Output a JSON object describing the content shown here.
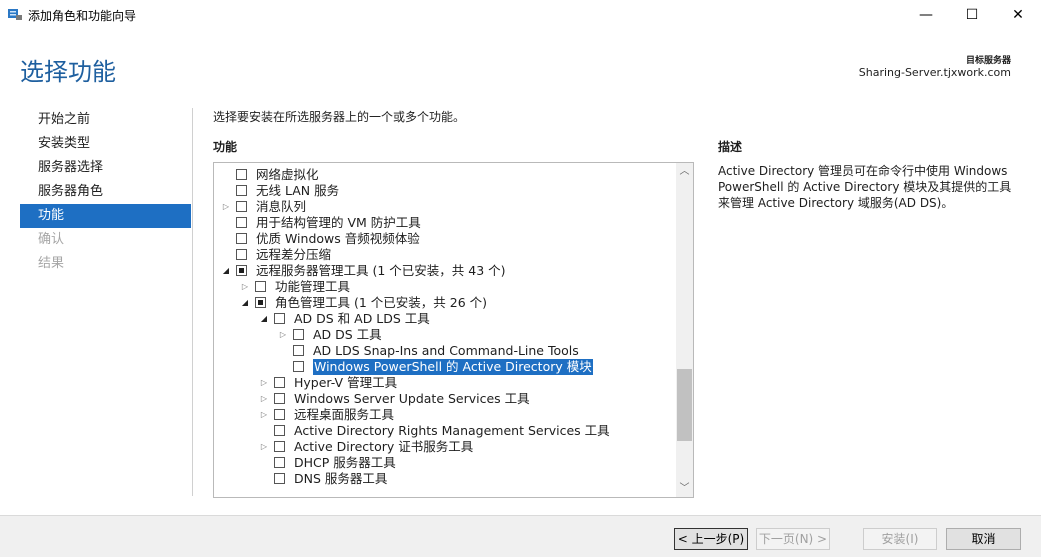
{
  "window": {
    "title": "添加角色和功能向导",
    "minimize_glyph": "—",
    "maximize_glyph": "☐",
    "close_glyph": "✕"
  },
  "header": {
    "page_title": "选择功能",
    "target_server_label": "目标服务器",
    "target_server_value": "Sharing-Server.tjxwork.com"
  },
  "nav": {
    "items": [
      {
        "label": "开始之前",
        "state": "normal"
      },
      {
        "label": "安装类型",
        "state": "normal"
      },
      {
        "label": "服务器选择",
        "state": "normal"
      },
      {
        "label": "服务器角色",
        "state": "normal"
      },
      {
        "label": "功能",
        "state": "active"
      },
      {
        "label": "确认",
        "state": "disabled"
      },
      {
        "label": "结果",
        "state": "disabled"
      }
    ]
  },
  "main": {
    "instruction": "选择要安装在所选服务器上的一个或多个功能。",
    "features_header": "功能",
    "description_header": "描述",
    "description_text": "Active Directory 管理员可在命令行中使用 Windows PowerShell 的 Active Directory 模块及其提供的工具来管理 Active Directory 域服务(AD DS)。"
  },
  "tree": {
    "rows": [
      {
        "label": "网络虚拟化",
        "level": 0,
        "expander": "none",
        "check": "empty"
      },
      {
        "label": "无线 LAN 服务",
        "level": 0,
        "expander": "none",
        "check": "empty"
      },
      {
        "label": "消息队列",
        "level": 0,
        "expander": "collapsed",
        "check": "empty"
      },
      {
        "label": "用于结构管理的 VM 防护工具",
        "level": 0,
        "expander": "none",
        "check": "empty"
      },
      {
        "label": "优质 Windows 音频视频体验",
        "level": 0,
        "expander": "none",
        "check": "empty"
      },
      {
        "label": "远程差分压缩",
        "level": 0,
        "expander": "none",
        "check": "empty"
      },
      {
        "label": "远程服务器管理工具 (1 个已安装，共 43 个)",
        "level": 0,
        "expander": "expanded",
        "check": "partial"
      },
      {
        "label": "功能管理工具",
        "level": 1,
        "expander": "collapsed",
        "check": "empty"
      },
      {
        "label": "角色管理工具 (1 个已安装，共 26 个)",
        "level": 1,
        "expander": "expanded",
        "check": "partial"
      },
      {
        "label": "AD DS 和 AD LDS 工具",
        "level": 2,
        "expander": "expanded",
        "check": "empty"
      },
      {
        "label": "AD DS 工具",
        "level": 3,
        "expander": "collapsed",
        "check": "empty"
      },
      {
        "label": "AD LDS Snap-Ins and Command-Line Tools",
        "level": 3,
        "expander": "none",
        "check": "empty"
      },
      {
        "label": "Windows PowerShell 的 Active Directory 模块",
        "level": 3,
        "expander": "none",
        "check": "empty",
        "selected": true
      },
      {
        "label": "Hyper-V 管理工具",
        "level": 2,
        "expander": "collapsed",
        "check": "empty"
      },
      {
        "label": "Windows Server Update Services 工具",
        "level": 2,
        "expander": "collapsed",
        "check": "empty"
      },
      {
        "label": "远程桌面服务工具",
        "level": 2,
        "expander": "collapsed",
        "check": "empty"
      },
      {
        "label": "Active Directory Rights Management Services 工具",
        "level": 2,
        "expander": "none",
        "check": "empty"
      },
      {
        "label": "Active Directory 证书服务工具",
        "level": 2,
        "expander": "collapsed",
        "check": "empty"
      },
      {
        "label": "DHCP 服务器工具",
        "level": 2,
        "expander": "none",
        "check": "empty"
      },
      {
        "label": "DNS 服务器工具",
        "level": 2,
        "expander": "none",
        "check": "empty"
      }
    ]
  },
  "footer": {
    "prev_label": "< 上一步(P)",
    "next_label": "下一页(N) >",
    "install_label": "安装(I)",
    "cancel_label": "取消"
  },
  "colors": {
    "accent": "#1e6fc3",
    "heading": "#1e5f9f",
    "disabled_text": "#a6a6a6"
  }
}
